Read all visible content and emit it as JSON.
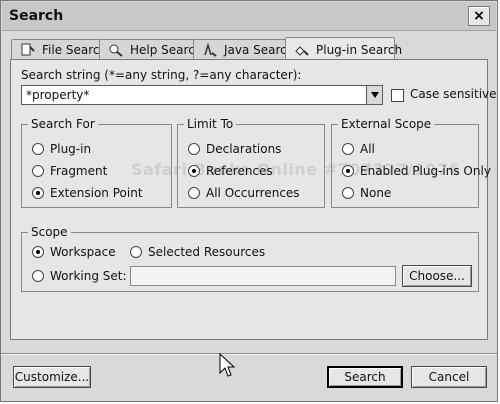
{
  "window": {
    "title": "Search",
    "close_glyph": "×"
  },
  "tabs": [
    {
      "label": "File Search",
      "icon": "file-search-icon"
    },
    {
      "label": "Help Search",
      "icon": "help-search-icon"
    },
    {
      "label": "Java Search",
      "icon": "java-search-icon"
    },
    {
      "label": "Plug-in Search",
      "icon": "plugin-search-icon",
      "active": true
    }
  ],
  "search": {
    "label": "Search string (*=any string, ?=any character):",
    "value": "*property*",
    "case_sensitive_label": "Case sensitive",
    "case_sensitive_checked": false
  },
  "search_for": {
    "title": "Search For",
    "options": [
      "Plug-in",
      "Fragment",
      "Extension Point"
    ],
    "selected_index": 2
  },
  "limit_to": {
    "title": "Limit To",
    "options": [
      "Declarations",
      "References",
      "All Occurrences"
    ],
    "selected_index": 1
  },
  "external_scope": {
    "title": "External Scope",
    "options": [
      "All",
      "Enabled Plug-ins Only",
      "None"
    ],
    "selected_index": 1
  },
  "scope": {
    "title": "Scope",
    "workspace_label": "Workspace",
    "selected_resources_label": "Selected Resources",
    "working_set_label": "Working Set:",
    "working_set_value": "",
    "choose_label": "Choose...",
    "selected": "workspace"
  },
  "footer": {
    "customize_label": "Customize...",
    "search_label": "Search",
    "cancel_label": "Cancel"
  },
  "watermark_text": "Safari Books Online #707327/1976"
}
